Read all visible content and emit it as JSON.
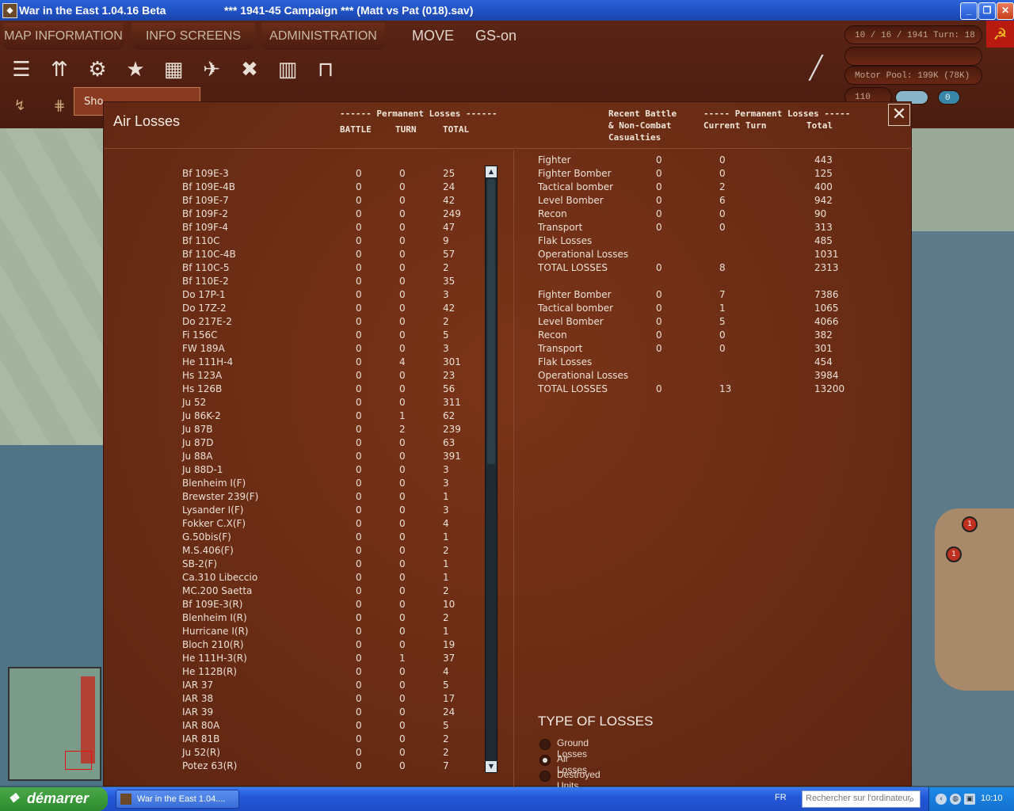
{
  "window": {
    "title": "War in the East 1.04.16 Beta",
    "campaign": "***   1941-45 Campaign   ***  (Matt vs Pat (018).sav)"
  },
  "menu": {
    "tabs": [
      "MAP INFORMATION",
      "INFO SCREENS",
      "ADMINISTRATION"
    ],
    "mode": "MOVE",
    "gs": "GS-on"
  },
  "status": {
    "date_turn": "10 / 16 / 1941   Turn: 18",
    "motor_pool": "Motor Pool:  199K (78K)",
    "counter": "110",
    "counter2": "0"
  },
  "tooltip_fragment": "Sho",
  "dialog": {
    "title": "Air Losses",
    "left_header": {
      "group": "------ Permanent Losses ------",
      "battle": "BATTLE",
      "turn": "TURN",
      "total": "TOTAL"
    },
    "right_header": {
      "recent1": "Recent Battle",
      "recent2": "& Non-Combat",
      "recent3": "Casualties",
      "group": "----- Permanent Losses -----",
      "current": "Current Turn",
      "total": "Total"
    },
    "aircraft": [
      {
        "name": "Bf 109E-3",
        "battle": "0",
        "turn": "0",
        "total": "25"
      },
      {
        "name": "Bf 109E-4B",
        "battle": "0",
        "turn": "0",
        "total": "24"
      },
      {
        "name": "Bf 109E-7",
        "battle": "0",
        "turn": "0",
        "total": "42"
      },
      {
        "name": "Bf 109F-2",
        "battle": "0",
        "turn": "0",
        "total": "249"
      },
      {
        "name": "Bf 109F-4",
        "battle": "0",
        "turn": "0",
        "total": "47"
      },
      {
        "name": "Bf 110C",
        "battle": "0",
        "turn": "0",
        "total": "9"
      },
      {
        "name": "Bf 110C-4B",
        "battle": "0",
        "turn": "0",
        "total": "57"
      },
      {
        "name": "Bf 110C-5",
        "battle": "0",
        "turn": "0",
        "total": "2"
      },
      {
        "name": "Bf 110E-2",
        "battle": "0",
        "turn": "0",
        "total": "35"
      },
      {
        "name": "Do 17P-1",
        "battle": "0",
        "turn": "0",
        "total": "3"
      },
      {
        "name": "Do 17Z-2",
        "battle": "0",
        "turn": "0",
        "total": "42"
      },
      {
        "name": "Do 217E-2",
        "battle": "0",
        "turn": "0",
        "total": "2"
      },
      {
        "name": "Fi 156C",
        "battle": "0",
        "turn": "0",
        "total": "5"
      },
      {
        "name": "FW 189A",
        "battle": "0",
        "turn": "0",
        "total": "3"
      },
      {
        "name": "He 111H-4",
        "battle": "0",
        "turn": "4",
        "total": "301"
      },
      {
        "name": "Hs 123A",
        "battle": "0",
        "turn": "0",
        "total": "23"
      },
      {
        "name": "Hs 126B",
        "battle": "0",
        "turn": "0",
        "total": "56"
      },
      {
        "name": "Ju 52",
        "battle": "0",
        "turn": "0",
        "total": "311"
      },
      {
        "name": "Ju 86K-2",
        "battle": "0",
        "turn": "1",
        "total": "62"
      },
      {
        "name": "Ju 87B",
        "battle": "0",
        "turn": "2",
        "total": "239"
      },
      {
        "name": "Ju 87D",
        "battle": "0",
        "turn": "0",
        "total": "63"
      },
      {
        "name": "Ju 88A",
        "battle": "0",
        "turn": "0",
        "total": "391"
      },
      {
        "name": "Ju 88D-1",
        "battle": "0",
        "turn": "0",
        "total": "3"
      },
      {
        "name": "Blenheim I(F)",
        "battle": "0",
        "turn": "0",
        "total": "3"
      },
      {
        "name": "Brewster 239(F)",
        "battle": "0",
        "turn": "0",
        "total": "1"
      },
      {
        "name": "Lysander I(F)",
        "battle": "0",
        "turn": "0",
        "total": "3"
      },
      {
        "name": "Fokker C.X(F)",
        "battle": "0",
        "turn": "0",
        "total": "4"
      },
      {
        "name": "G.50bis(F)",
        "battle": "0",
        "turn": "0",
        "total": "1"
      },
      {
        "name": "M.S.406(F)",
        "battle": "0",
        "turn": "0",
        "total": "2"
      },
      {
        "name": "SB-2(F)",
        "battle": "0",
        "turn": "0",
        "total": "1"
      },
      {
        "name": "Ca.310 Libeccio",
        "battle": "0",
        "turn": "0",
        "total": "1"
      },
      {
        "name": "MC.200 Saetta",
        "battle": "0",
        "turn": "0",
        "total": "2"
      },
      {
        "name": "Bf 109E-3(R)",
        "battle": "0",
        "turn": "0",
        "total": "10"
      },
      {
        "name": "Blenheim I(R)",
        "battle": "0",
        "turn": "0",
        "total": "2"
      },
      {
        "name": "Hurricane I(R)",
        "battle": "0",
        "turn": "0",
        "total": "1"
      },
      {
        "name": "Bloch 210(R)",
        "battle": "0",
        "turn": "0",
        "total": "19"
      },
      {
        "name": "He 111H-3(R)",
        "battle": "0",
        "turn": "1",
        "total": "37"
      },
      {
        "name": "He 112B(R)",
        "battle": "0",
        "turn": "0",
        "total": "4"
      },
      {
        "name": "IAR 37",
        "battle": "0",
        "turn": "0",
        "total": "5"
      },
      {
        "name": "IAR 38",
        "battle": "0",
        "turn": "0",
        "total": "17"
      },
      {
        "name": "IAR 39",
        "battle": "0",
        "turn": "0",
        "total": "24"
      },
      {
        "name": "IAR 80A",
        "battle": "0",
        "turn": "0",
        "total": "5"
      },
      {
        "name": "IAR 81B",
        "battle": "0",
        "turn": "0",
        "total": "2"
      },
      {
        "name": "Ju 52(R)",
        "battle": "0",
        "turn": "0",
        "total": "2"
      },
      {
        "name": "Potez 63(R)",
        "battle": "0",
        "turn": "0",
        "total": "7"
      }
    ],
    "summary_axis": [
      {
        "type": "Fighter",
        "recent": "0",
        "current": "0",
        "total": "443"
      },
      {
        "type": "Fighter Bomber",
        "recent": "0",
        "current": "0",
        "total": "125"
      },
      {
        "type": "Tactical bomber",
        "recent": "0",
        "current": "2",
        "total": "400"
      },
      {
        "type": "Level Bomber",
        "recent": "0",
        "current": "6",
        "total": "942"
      },
      {
        "type": "Recon",
        "recent": "0",
        "current": "0",
        "total": "90"
      },
      {
        "type": "Transport",
        "recent": "0",
        "current": "0",
        "total": "313"
      },
      {
        "type": "Flak Losses",
        "recent": "",
        "current": "",
        "total": "485"
      },
      {
        "type": "Operational Losses",
        "recent": "",
        "current": "",
        "total": "1031"
      },
      {
        "type": "TOTAL LOSSES",
        "recent": "0",
        "current": "8",
        "total": "2313"
      }
    ],
    "summary_soviet": [
      {
        "type": "Fighter Bomber",
        "recent": "0",
        "current": "7",
        "total": "7386"
      },
      {
        "type": "Tactical bomber",
        "recent": "0",
        "current": "1",
        "total": "1065"
      },
      {
        "type": "Level Bomber",
        "recent": "0",
        "current": "5",
        "total": "4066"
      },
      {
        "type": "Recon",
        "recent": "0",
        "current": "0",
        "total": "382"
      },
      {
        "type": "Transport",
        "recent": "0",
        "current": "0",
        "total": "301"
      },
      {
        "type": "Flak Losses",
        "recent": "",
        "current": "",
        "total": "454"
      },
      {
        "type": "Operational Losses",
        "recent": "",
        "current": "",
        "total": "3984"
      },
      {
        "type": "TOTAL LOSSES",
        "recent": "0",
        "current": "13",
        "total": "13200"
      }
    ],
    "type_of_losses": {
      "title": "TYPE OF LOSSES",
      "options": [
        "Ground Losses",
        "Air Losses",
        "Destroyed Units"
      ],
      "selected": "Air Losses"
    }
  },
  "taskbar": {
    "start": "démarrer",
    "task": "War in the East 1.04....",
    "lang": "FR",
    "search_placeholder": "Rechercher sur l'ordinateur",
    "clock": "10:10"
  },
  "colors": {
    "dialog_bg": "#6a2c18",
    "taskbar": "#2458d8",
    "start_green": "#3a9a3a"
  }
}
